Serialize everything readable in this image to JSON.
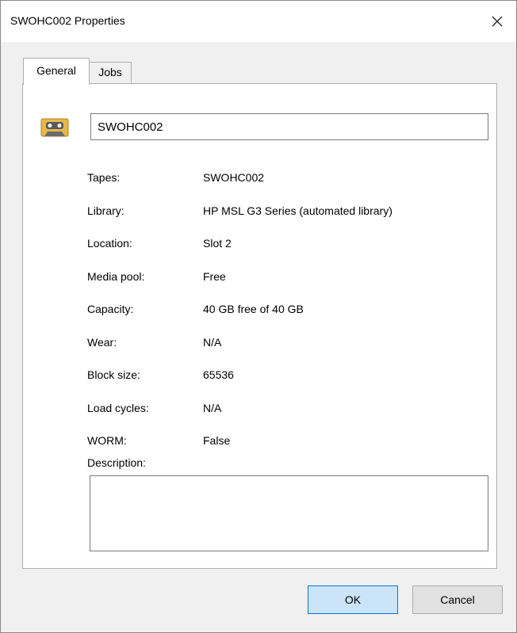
{
  "window": {
    "title": "SWOHC002 Properties",
    "close_icon": "close-icon"
  },
  "tabs": [
    {
      "label": "General"
    },
    {
      "label": "Jobs"
    }
  ],
  "general": {
    "icon": "tape-cassette-icon",
    "name_value": "SWOHC002",
    "properties": [
      {
        "label": "Tapes:",
        "value": "SWOHC002"
      },
      {
        "label": "Library:",
        "value": "HP MSL G3 Series (automated library)"
      },
      {
        "label": "Location:",
        "value": "Slot 2"
      },
      {
        "label": "Media pool:",
        "value": "Free"
      },
      {
        "label": "Capacity:",
        "value": "40 GB free of 40 GB"
      },
      {
        "label": "Wear:",
        "value": "N/A"
      },
      {
        "label": "Block size:",
        "value": "65536"
      },
      {
        "label": "Load cycles:",
        "value": "N/A"
      },
      {
        "label": "WORM:",
        "value": "False"
      }
    ],
    "description_label": "Description:",
    "description_value": ""
  },
  "buttons": {
    "ok_label": "OK",
    "cancel_label": "Cancel"
  },
  "colors": {
    "accent": "#0078d7",
    "ok_fill": "#cce4f7",
    "tape_body": "#e8b84a",
    "tape_dark": "#6b6b6b"
  }
}
